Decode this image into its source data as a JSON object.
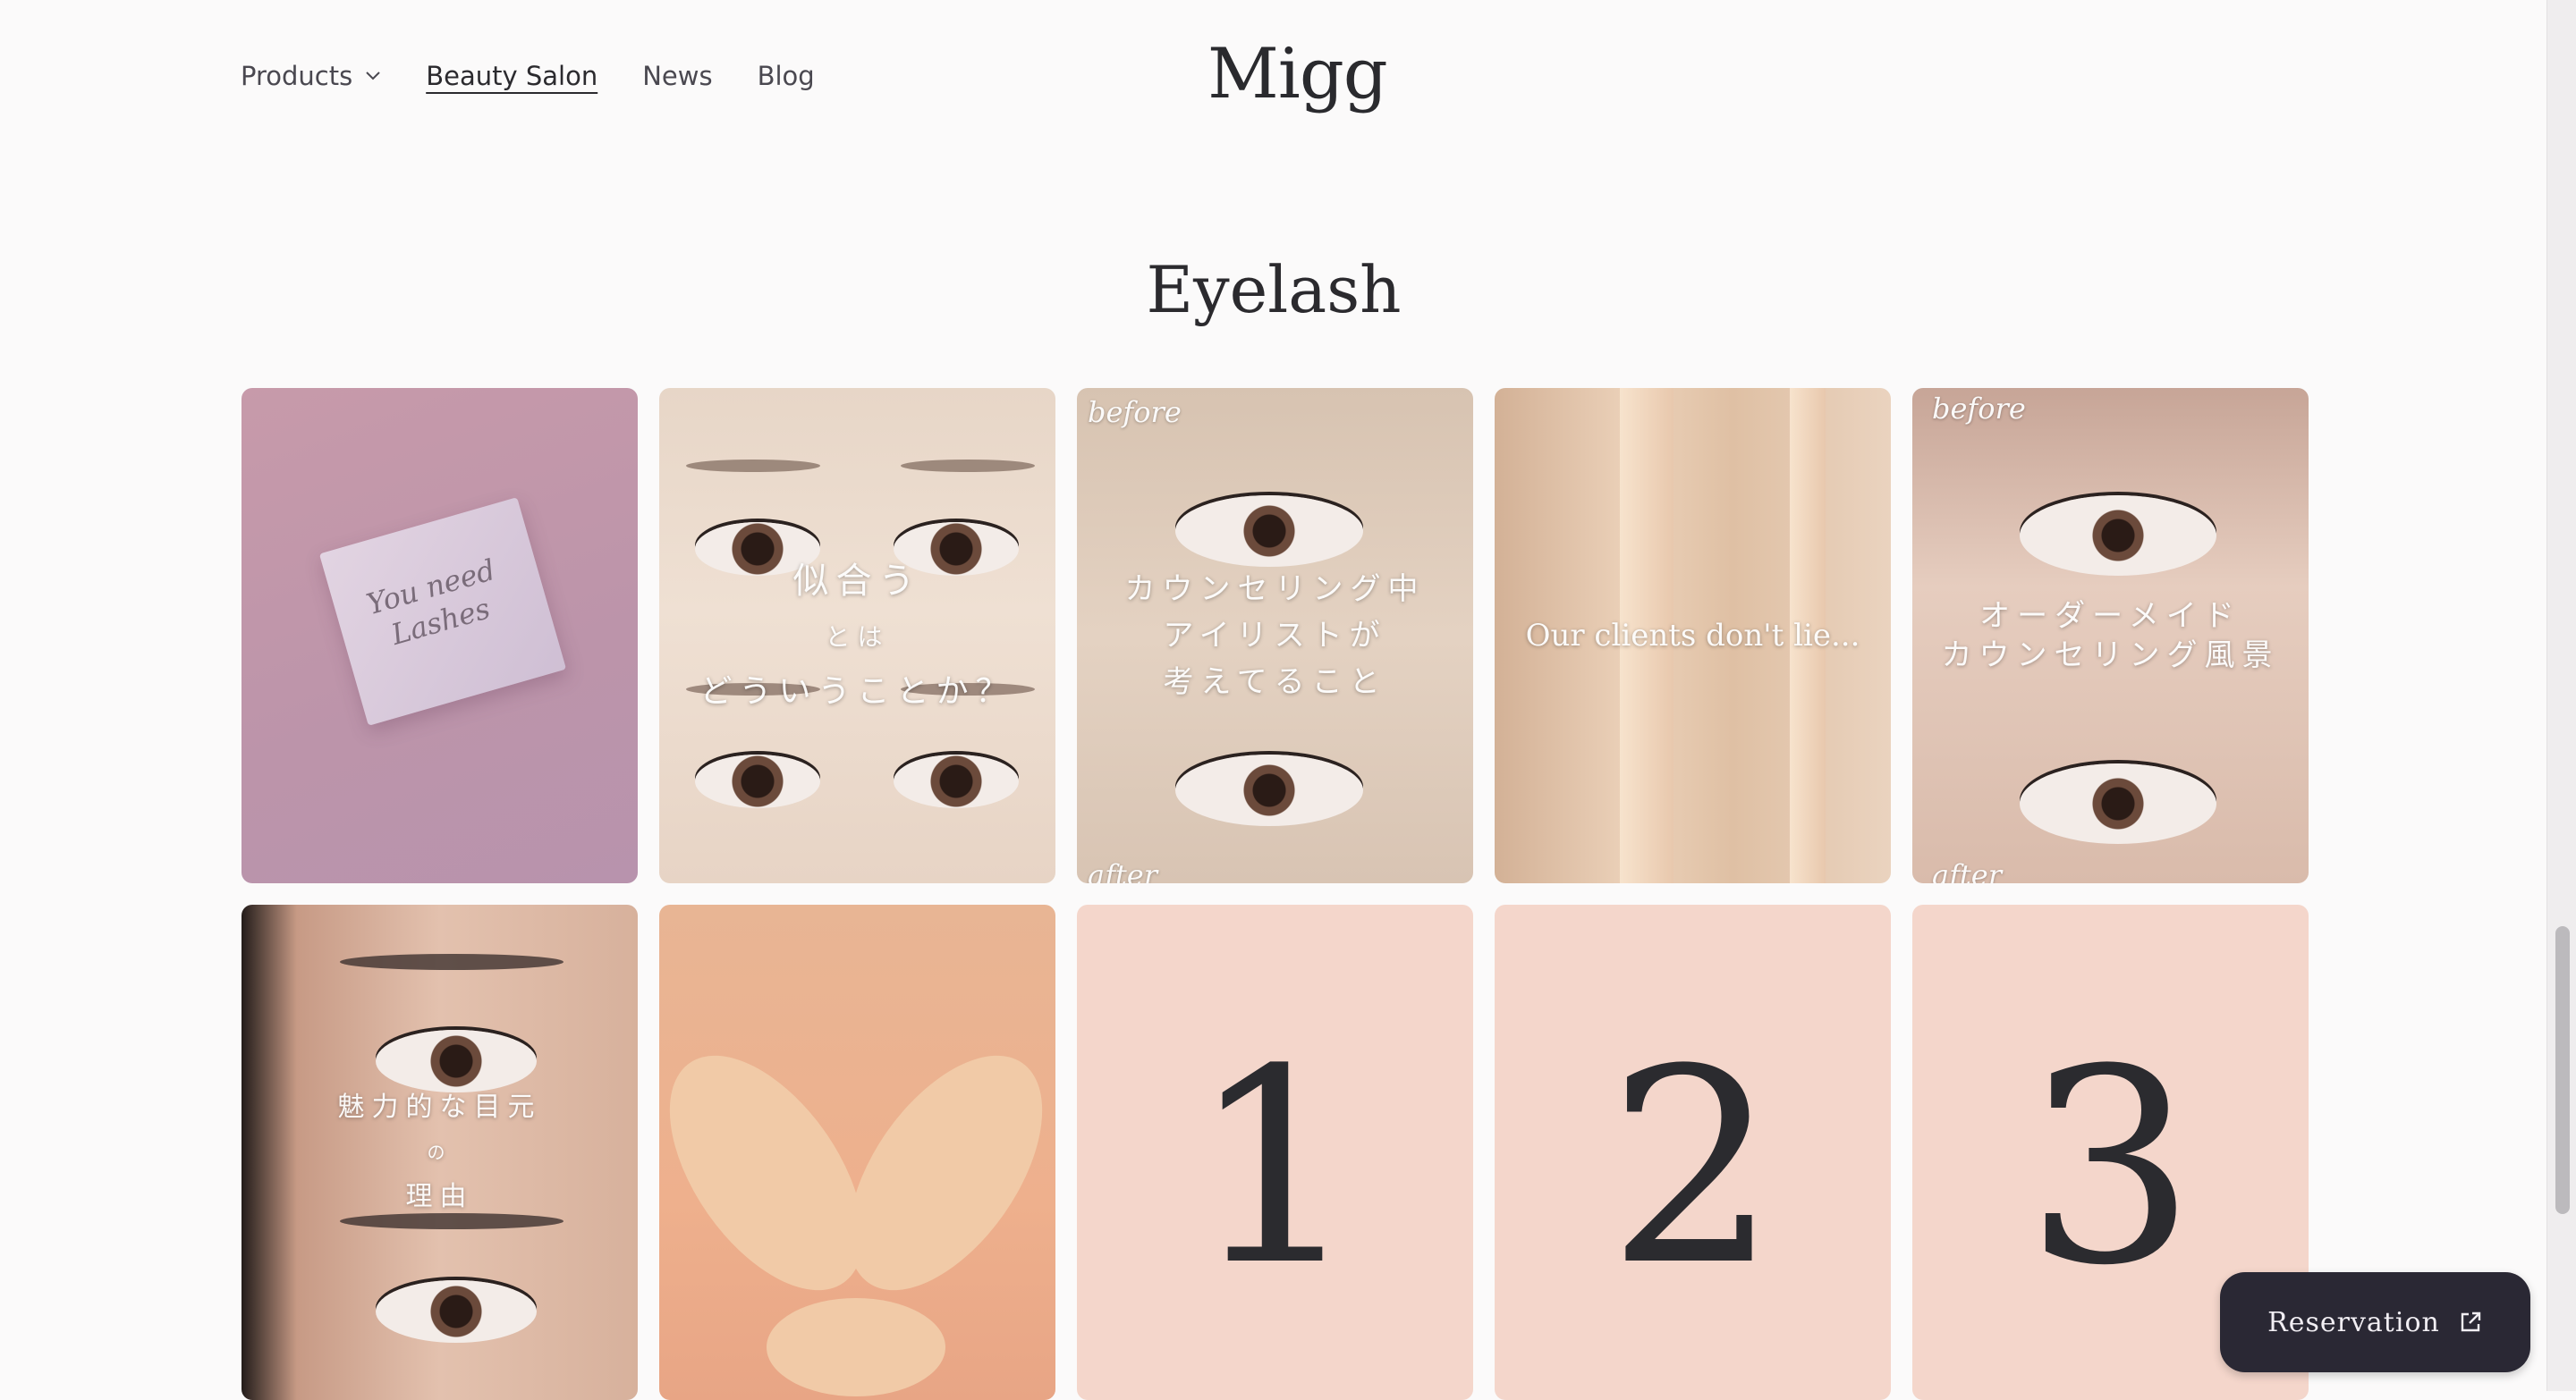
{
  "header": {
    "nav": [
      {
        "label": "Products",
        "has_dropdown": true
      },
      {
        "label": "Beauty Salon",
        "active": true
      },
      {
        "label": "News"
      },
      {
        "label": "Blog"
      }
    ],
    "logo": "Migg"
  },
  "section": {
    "title": "Eyelash"
  },
  "tiles": [
    {
      "card_text": "You need\nLashes"
    },
    {
      "caption_1": "似合う",
      "caption_2": "とは",
      "caption_3": "どういうことか？"
    },
    {
      "top_label": "before",
      "bottom_label": "after",
      "caption": "カウンセリング中\nアイリストが\n考えてること"
    },
    {
      "caption": "Our clients don't lie..."
    },
    {
      "top_label": "before",
      "bottom_label": "after",
      "caption": "オーダーメイド\nカウンセリング風景"
    },
    {
      "caption_1": "魅力的な目元",
      "caption_2": "の",
      "caption_3": "理由"
    },
    {},
    {
      "number": "1"
    },
    {
      "number": "2"
    },
    {
      "number": "3"
    }
  ],
  "reservation": {
    "label": "Reservation",
    "icon": "external-link-icon"
  },
  "colors": {
    "background": "#fbfafa",
    "button": "#2a2834",
    "number_tile": "#f4d6cb"
  }
}
